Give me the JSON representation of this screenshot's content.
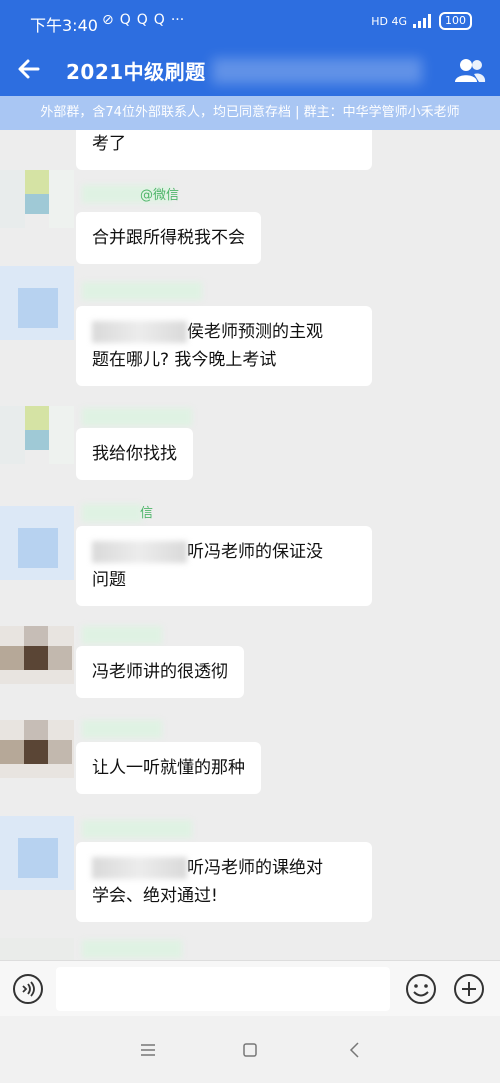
{
  "status": {
    "time": "下午3:40",
    "icons_left": [
      "⊘",
      "Q",
      "Q",
      "Q",
      "···"
    ],
    "signal_text": "HD 4G",
    "battery": "100"
  },
  "header": {
    "title": "2021中级刷题",
    "notice": "外部群，含74位外部联系人，均已同意存档 | 群主：中华学管师小禾老师"
  },
  "messages": [
    {
      "name_tag": "",
      "lines": [
        "考了"
      ]
    },
    {
      "name_tag": "@微信",
      "lines": [
        "合并跟所得税我不会"
      ]
    },
    {
      "name_tag": "",
      "lines": [
        "侯老师预测的主观",
        "题在哪儿? 我今晚上考试"
      ]
    },
    {
      "name_tag": "",
      "lines": [
        "我给你找找"
      ]
    },
    {
      "name_tag": "信",
      "lines": [
        "听冯老师的保证没",
        "问题"
      ]
    },
    {
      "name_tag": "",
      "lines": [
        "冯老师讲的很透彻"
      ]
    },
    {
      "name_tag": "",
      "lines": [
        "让人一听就懂的那种"
      ]
    },
    {
      "name_tag": "",
      "lines": [
        "听冯老师的课绝对",
        "学会、绝对通过!"
      ]
    }
  ],
  "input": {
    "value": "",
    "placeholder": ""
  },
  "colors": {
    "header": "#2d6ee0",
    "notice": "#a9c6f3",
    "bg": "#ededed",
    "name_green": "#4fb56a"
  }
}
